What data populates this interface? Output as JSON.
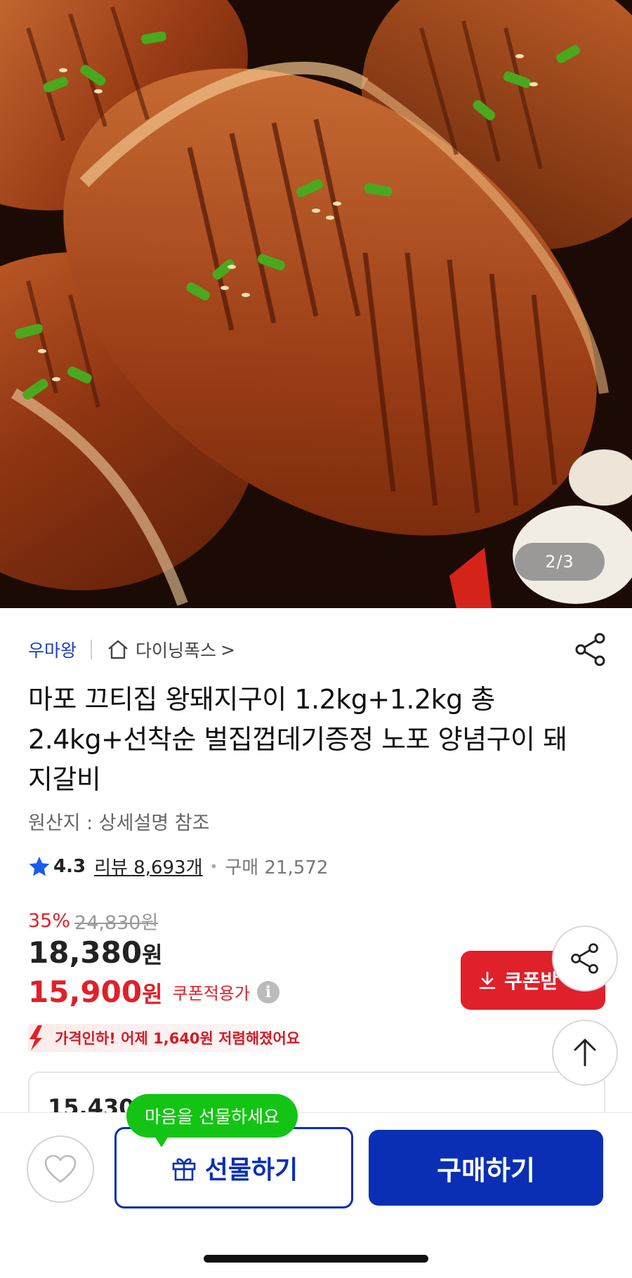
{
  "gallery": {
    "page_indicator": "2/3",
    "image_description_icon": "grilled-pork-galbi-photo"
  },
  "store": {
    "brand": "우마왕",
    "shop_name": "다이닝폭스",
    "chevron": ">"
  },
  "product": {
    "title": "마포 끄티집 왕돼지구이 1.2kg+1.2kg 총2.4kg+선착순 벌집껍데기증정 노포 양념구이 돼지갈비",
    "origin": "원산지 : 상세설명 참조",
    "rating": "4.3",
    "reviews": "리뷰 8,693개",
    "dot": "•",
    "purchases": "구매 21,572"
  },
  "pricing": {
    "discount": "35%",
    "original_price": "24,830원",
    "sale_price_number": "18,380",
    "sale_price_unit": "원",
    "coupon_price_number": "15,900",
    "coupon_price_unit": "원",
    "coupon_note": "쿠폰적용가",
    "info_symbol": "i",
    "coupon_button": "쿠폰받",
    "price_drop_notice": "가격인하! 어제 1,640원 저렴해졌어요"
  },
  "card": {
    "partial_text": "15,430"
  },
  "bottom_bar": {
    "tooltip": "마음을 선물하세요",
    "gift_button": "선물하기",
    "buy_button": "구매하기"
  },
  "colors": {
    "brand_blue": "#0a2fb4",
    "sale_red": "#e0202a",
    "tooltip_green": "#14c414"
  }
}
